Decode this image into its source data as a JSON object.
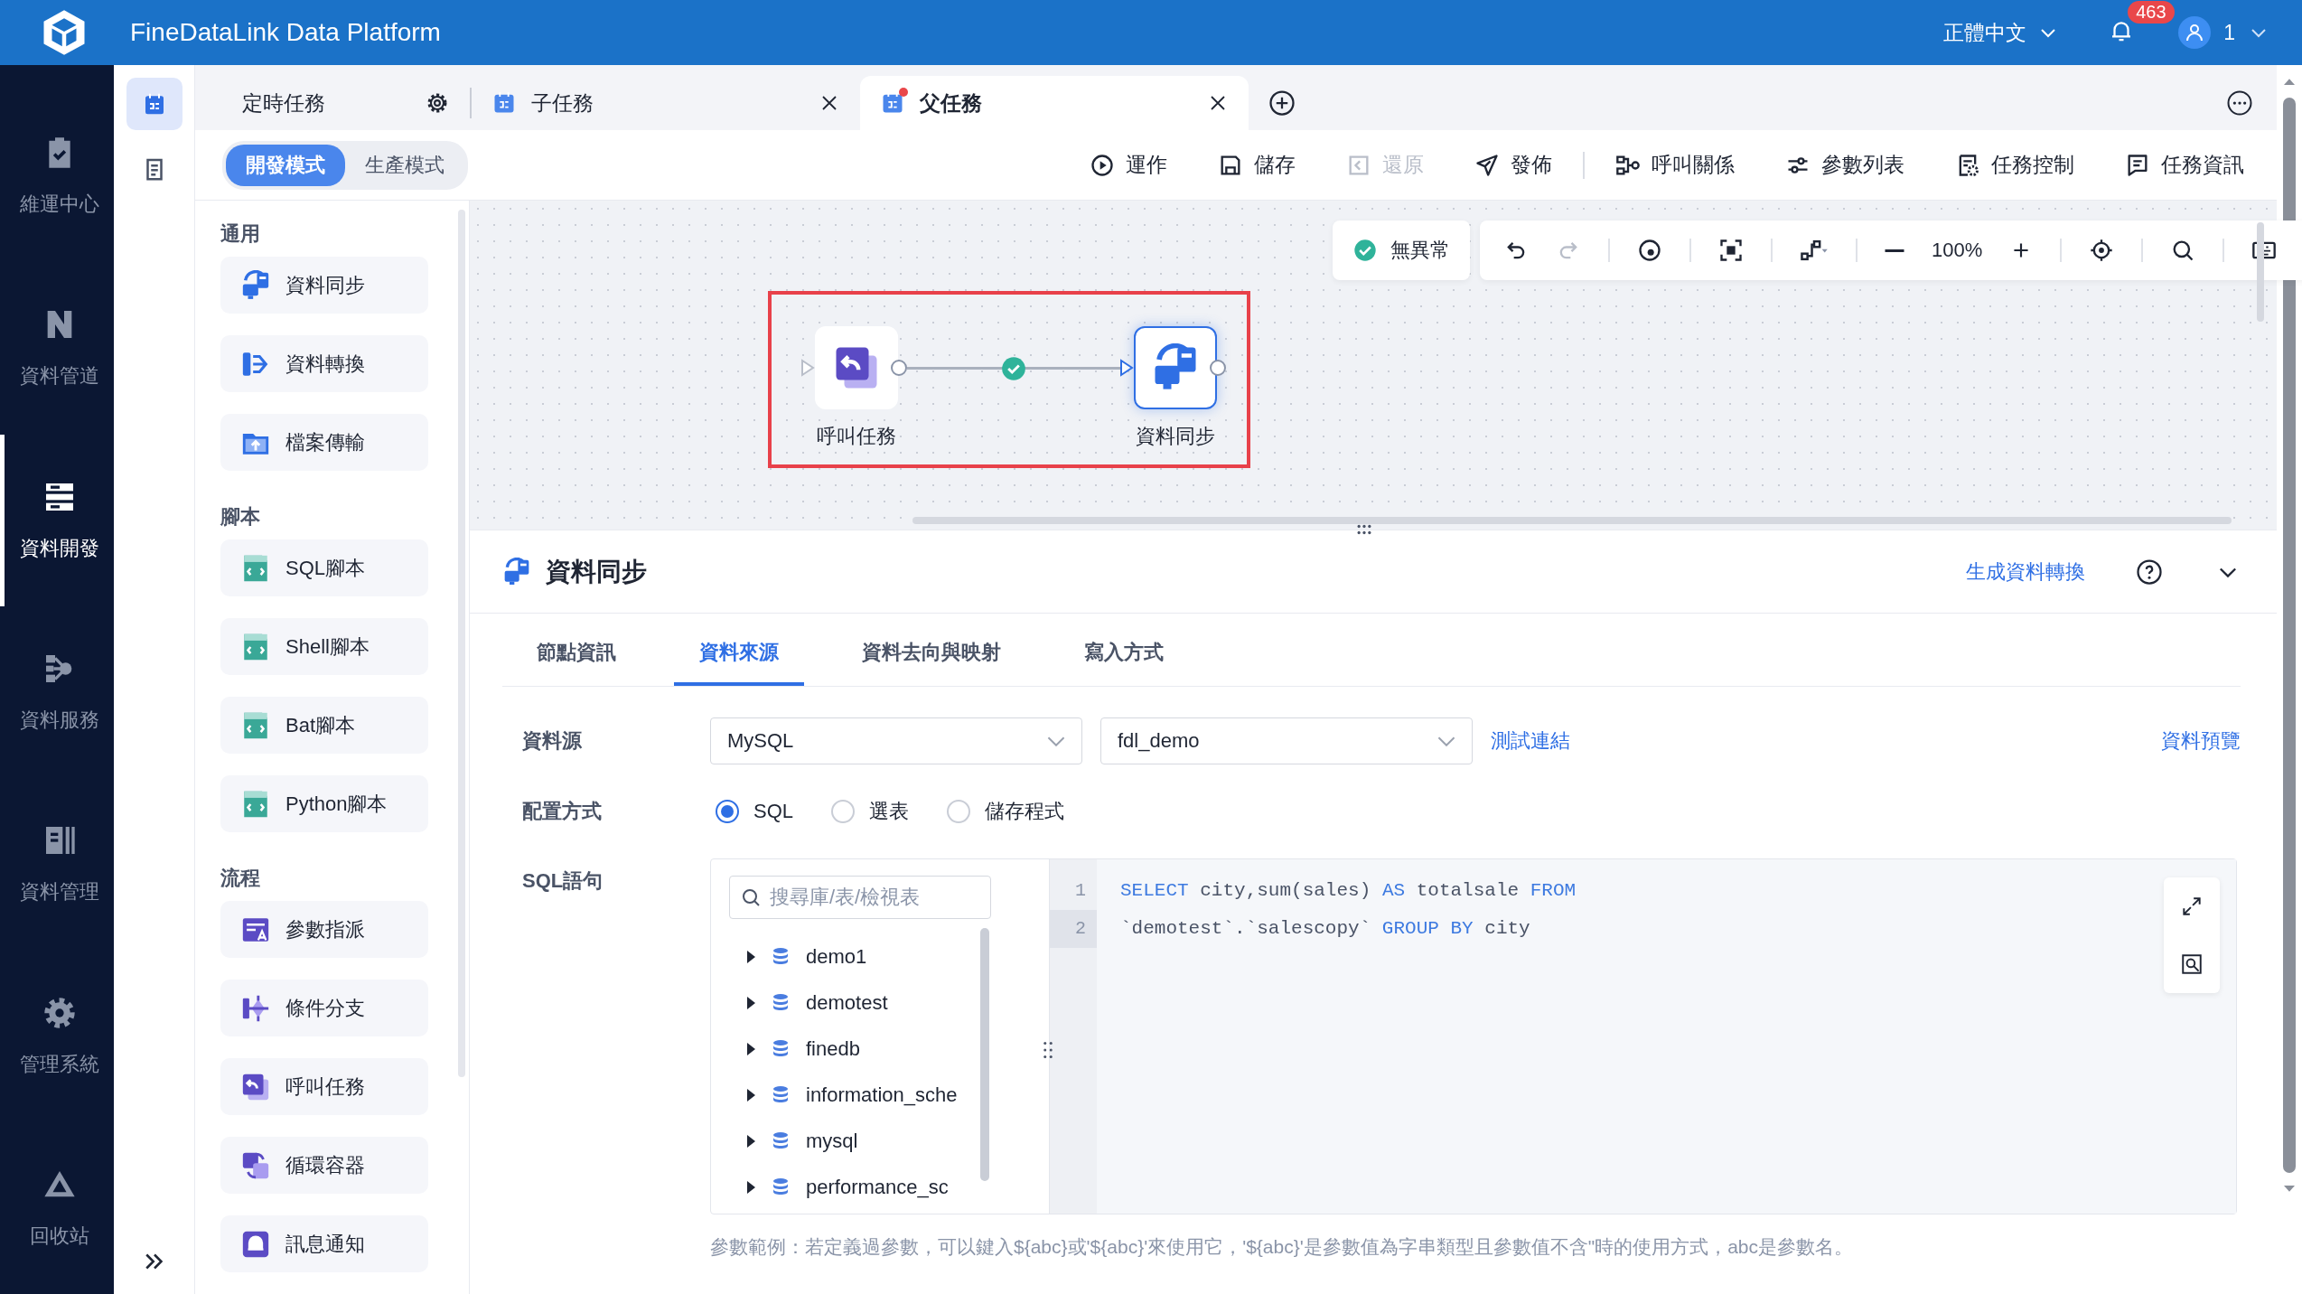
{
  "header": {
    "title": "FineDataLink Data Platform",
    "language": "正體中文",
    "notification_count": "463",
    "user": "1"
  },
  "nav": [
    {
      "label": "維運中心",
      "selected": false
    },
    {
      "label": "資料管道",
      "selected": false
    },
    {
      "label": "資料開發",
      "selected": true
    },
    {
      "label": "資料服務",
      "selected": false
    },
    {
      "label": "資料管理",
      "selected": false
    },
    {
      "label": "管理系統",
      "selected": false
    },
    {
      "label": "回收站",
      "selected": false
    }
  ],
  "subnav": [
    {
      "selected": true
    },
    {
      "selected": false
    }
  ],
  "tabs": [
    {
      "label": "定時任務",
      "kind": "scheduled",
      "selected": false,
      "modified": false
    },
    {
      "label": "子任務",
      "kind": "task",
      "selected": false,
      "modified": false
    },
    {
      "label": "父任務",
      "kind": "task",
      "selected": true,
      "modified": true
    }
  ],
  "modes": [
    {
      "label": "開發模式",
      "selected": true
    },
    {
      "label": "生產模式",
      "selected": false
    }
  ],
  "actions": [
    [
      {
        "label": "運作",
        "disabled": false
      },
      {
        "label": "儲存",
        "disabled": false
      },
      {
        "label": "還原",
        "disabled": true
      },
      {
        "label": "發佈",
        "disabled": false
      }
    ],
    [
      {
        "label": "呼叫關係",
        "disabled": false
      },
      {
        "label": "參數列表",
        "disabled": false
      },
      {
        "label": "任務控制",
        "disabled": false
      },
      {
        "label": "任務資訊",
        "disabled": false
      }
    ]
  ],
  "components": [
    {
      "heading": "通用",
      "items": [
        {
          "label": "資料同步",
          "kind": "sync"
        },
        {
          "label": "資料轉換",
          "kind": "transform"
        },
        {
          "label": "檔案傳輸",
          "kind": "file"
        }
      ]
    },
    {
      "heading": "腳本",
      "items": [
        {
          "label": "SQL腳本",
          "kind": "script"
        },
        {
          "label": "Shell腳本",
          "kind": "script"
        },
        {
          "label": "Bat腳本",
          "kind": "script"
        },
        {
          "label": "Python腳本",
          "kind": "script"
        }
      ]
    },
    {
      "heading": "流程",
      "items": [
        {
          "label": "參數指派",
          "kind": "param"
        },
        {
          "label": "條件分支",
          "kind": "branch"
        },
        {
          "label": "呼叫任務",
          "kind": "call"
        },
        {
          "label": "循環容器",
          "kind": "loop"
        },
        {
          "label": "訊息通知",
          "kind": "notify"
        }
      ]
    }
  ],
  "canvas": {
    "status": "無異常",
    "zoom": "100%",
    "nodes": [
      {
        "label": "呼叫任務",
        "kind": "call",
        "selected": false
      },
      {
        "label": "資料同步",
        "kind": "sync",
        "selected": true
      }
    ],
    "edge": {
      "success": true
    }
  },
  "detail": {
    "title": "資料同步",
    "generate_link": "生成資料轉換",
    "tabs": [
      {
        "label": "節點資訊",
        "selected": false
      },
      {
        "label": "資料來源",
        "selected": true
      },
      {
        "label": "資料去向與映射",
        "selected": false
      },
      {
        "label": "寫入方式",
        "selected": false
      }
    ],
    "source": {
      "label": "資料源",
      "type": "MySQL",
      "database": "fdl_demo",
      "test_link": "測試連結",
      "preview_link": "資料預覽"
    },
    "config": {
      "label": "配置方式",
      "options": [
        {
          "label": "SQL",
          "selected": true
        },
        {
          "label": "選表",
          "selected": false
        },
        {
          "label": "儲存程式",
          "selected": false
        }
      ]
    },
    "sql": {
      "label": "SQL語句",
      "search_placeholder": "搜尋庫/表/檢視表",
      "databases": [
        {
          "name": "demo1",
          "expanded": false
        },
        {
          "name": "demotest",
          "expanded": false
        },
        {
          "name": "finedb",
          "expanded": false
        },
        {
          "name": "information_sche",
          "expanded": false
        },
        {
          "name": "mysql",
          "expanded": false
        },
        {
          "name": "performance_sc",
          "expanded": false
        }
      ],
      "lines": [
        {
          "number": "1",
          "selected": false,
          "tokens": [
            {
              "text": "SELECT",
              "kind": "keyword"
            },
            {
              "text": " city,sum(sales) ",
              "kind": "plain"
            },
            {
              "text": "AS",
              "kind": "keyword"
            },
            {
              "text": " totalsale ",
              "kind": "plain"
            },
            {
              "text": "FROM",
              "kind": "keyword"
            }
          ]
        },
        {
          "number": "2",
          "selected": true,
          "tokens": [
            {
              "text": "`demotest`.`salescopy` ",
              "kind": "plain"
            },
            {
              "text": "GROUP BY",
              "kind": "keyword"
            },
            {
              "text": " city",
              "kind": "plain"
            }
          ]
        }
      ]
    },
    "hint": "參數範例：若定義過參數，可以鍵入${abc}或'${abc}'來使用它，'${abc}'是參數值為字串類型且參數值不含\"時的使用方式，abc是參數名。"
  }
}
